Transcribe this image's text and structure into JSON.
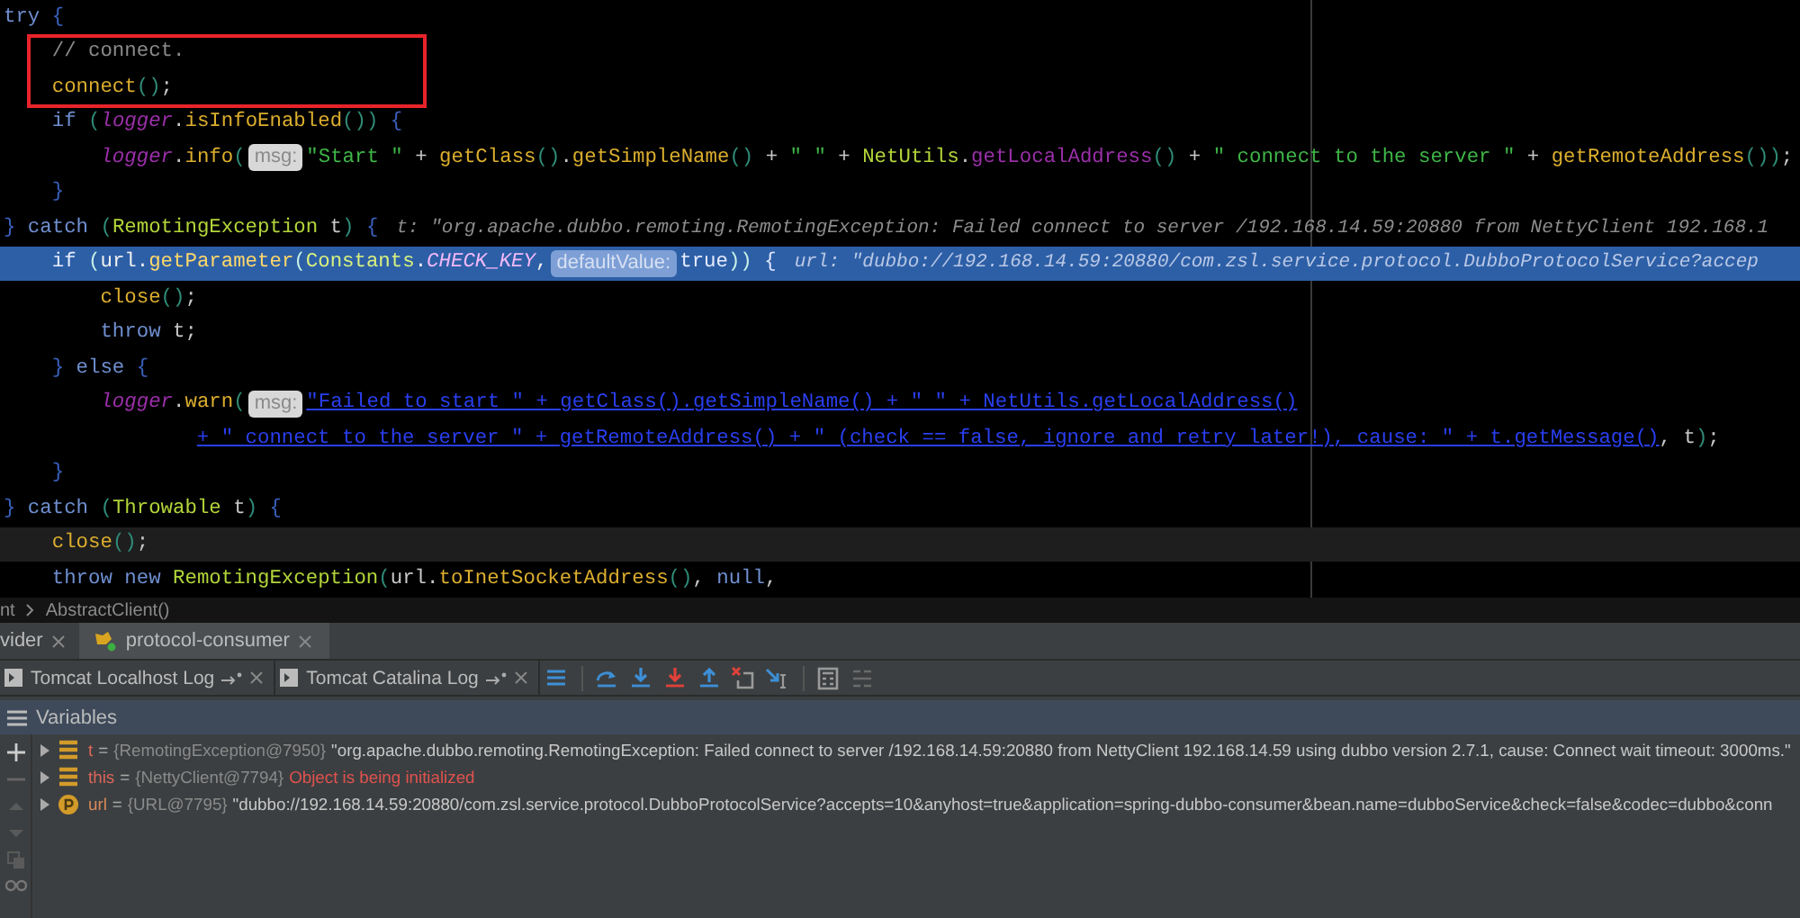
{
  "code": {
    "lines": [
      {
        "selected": false,
        "current": false,
        "boxed": false,
        "tokens": [
          {
            "kind": "kw",
            "text": "try"
          },
          {
            "kind": "brace",
            "text": " {"
          }
        ]
      },
      {
        "selected": false,
        "current": false,
        "boxed": true,
        "tokens": [
          {
            "kind": "comment",
            "text": "    // connect."
          }
        ]
      },
      {
        "selected": false,
        "current": false,
        "boxed": true,
        "tokens": [
          {
            "kind": "call",
            "text": "    connect"
          },
          {
            "kind": "paren",
            "text": "()"
          },
          {
            "kind": "plain",
            "text": ";"
          }
        ]
      },
      {
        "selected": false,
        "current": false,
        "boxed": false,
        "tokens": [
          {
            "kind": "kw",
            "text": "    if"
          },
          {
            "kind": "paren",
            "text": " ("
          },
          {
            "kind": "field",
            "text": "logger"
          },
          {
            "kind": "plain",
            "text": "."
          },
          {
            "kind": "call",
            "text": "isInfoEnabled"
          },
          {
            "kind": "paren",
            "text": "())"
          },
          {
            "kind": "brace",
            "text": " {"
          }
        ]
      },
      {
        "selected": false,
        "current": false,
        "boxed": false,
        "tokens": [
          {
            "kind": "field",
            "text": "        logger"
          },
          {
            "kind": "plain",
            "text": "."
          },
          {
            "kind": "call",
            "text": "info"
          },
          {
            "kind": "paren",
            "text": "("
          },
          {
            "kind": "hint",
            "text": "msg:"
          },
          {
            "kind": "str",
            "text": "\"Start \""
          },
          {
            "kind": "plain",
            "text": " + "
          },
          {
            "kind": "call",
            "text": "getClass"
          },
          {
            "kind": "paren",
            "text": "()"
          },
          {
            "kind": "plain",
            "text": "."
          },
          {
            "kind": "call",
            "text": "getSimpleName"
          },
          {
            "kind": "paren",
            "text": "()"
          },
          {
            "kind": "plain",
            "text": " + "
          },
          {
            "kind": "str",
            "text": "\" \""
          },
          {
            "kind": "plain",
            "text": " + "
          },
          {
            "kind": "cls",
            "text": "NetUtils"
          },
          {
            "kind": "plain",
            "text": "."
          },
          {
            "kind": "static",
            "text": "getLocalAddress"
          },
          {
            "kind": "paren",
            "text": "()"
          },
          {
            "kind": "plain",
            "text": " + "
          },
          {
            "kind": "str",
            "text": "\" connect to the server \""
          },
          {
            "kind": "plain",
            "text": " + "
          },
          {
            "kind": "call",
            "text": "getRemoteAddress"
          },
          {
            "kind": "paren",
            "text": "())"
          },
          {
            "kind": "plain",
            "text": ";"
          }
        ]
      },
      {
        "selected": false,
        "current": false,
        "boxed": false,
        "tokens": [
          {
            "kind": "brace",
            "text": "    }"
          }
        ]
      },
      {
        "selected": false,
        "current": false,
        "boxed": false,
        "tokens": [
          {
            "kind": "brace",
            "text": "}"
          },
          {
            "kind": "kw",
            "text": " catch"
          },
          {
            "kind": "paren",
            "text": " ("
          },
          {
            "kind": "cls",
            "text": "RemotingException"
          },
          {
            "kind": "plain",
            "text": " t"
          },
          {
            "kind": "paren",
            "text": ")"
          },
          {
            "kind": "brace",
            "text": " {"
          },
          {
            "kind": "debug",
            "text": "t: \"org.apache.dubbo.remoting.RemotingException: Failed connect to server /192.168.14.59:20880 from NettyClient 192.168.1"
          }
        ]
      },
      {
        "selected": true,
        "current": false,
        "boxed": false,
        "tokens": [
          {
            "kind": "kw",
            "text": "    if"
          },
          {
            "kind": "paren",
            "text": " ("
          },
          {
            "kind": "plain",
            "text": "url."
          },
          {
            "kind": "call",
            "text": "getParameter"
          },
          {
            "kind": "paren",
            "text": "("
          },
          {
            "kind": "cls",
            "text": "Constants"
          },
          {
            "kind": "plain",
            "text": "."
          },
          {
            "kind": "field",
            "text": "CHECK_KEY"
          },
          {
            "kind": "plain",
            "text": ","
          },
          {
            "kind": "hint",
            "text": "defaultValue:"
          },
          {
            "kind": "kw",
            "text": "true"
          },
          {
            "kind": "paren",
            "text": "))"
          },
          {
            "kind": "brace",
            "text": " {"
          },
          {
            "kind": "debug",
            "text": "url: \"dubbo://192.168.14.59:20880/com.zsl.service.protocol.DubboProtocolService?accep"
          }
        ]
      },
      {
        "selected": false,
        "current": false,
        "boxed": false,
        "tokens": [
          {
            "kind": "call",
            "text": "        close"
          },
          {
            "kind": "paren",
            "text": "()"
          },
          {
            "kind": "plain",
            "text": ";"
          }
        ]
      },
      {
        "selected": false,
        "current": false,
        "boxed": false,
        "tokens": [
          {
            "kind": "kw",
            "text": "        throw"
          },
          {
            "kind": "plain",
            "text": " t;"
          }
        ]
      },
      {
        "selected": false,
        "current": false,
        "boxed": false,
        "tokens": [
          {
            "kind": "brace",
            "text": "    }"
          },
          {
            "kind": "kw",
            "text": " else"
          },
          {
            "kind": "brace",
            "text": " {"
          }
        ]
      },
      {
        "selected": false,
        "current": false,
        "boxed": false,
        "tokens": [
          {
            "kind": "field",
            "text": "        logger"
          },
          {
            "kind": "plain",
            "text": "."
          },
          {
            "kind": "call",
            "text": "warn"
          },
          {
            "kind": "paren",
            "text": "("
          },
          {
            "kind": "hint",
            "text": "msg:"
          },
          {
            "kind": "link",
            "text": "\"Failed to start \" + getClass().getSimpleName() + \" \" + NetUtils.getLocalAddress()"
          }
        ]
      },
      {
        "selected": false,
        "current": false,
        "boxed": false,
        "tokens": [
          {
            "kind": "link",
            "text": "                + \" connect to the server \" + getRemoteAddress() + \" (check == false, ignore and retry later!), cause: \" + t.getMessage()"
          },
          {
            "kind": "plain",
            "text": ", t"
          },
          {
            "kind": "paren",
            "text": ")"
          },
          {
            "kind": "plain",
            "text": ";"
          }
        ]
      },
      {
        "selected": false,
        "current": false,
        "boxed": false,
        "tokens": [
          {
            "kind": "brace",
            "text": "    }"
          }
        ]
      },
      {
        "selected": false,
        "current": false,
        "boxed": false,
        "tokens": [
          {
            "kind": "brace",
            "text": "}"
          },
          {
            "kind": "kw",
            "text": " catch"
          },
          {
            "kind": "paren",
            "text": " ("
          },
          {
            "kind": "cls",
            "text": "Throwable"
          },
          {
            "kind": "plain",
            "text": " t"
          },
          {
            "kind": "paren",
            "text": ")"
          },
          {
            "kind": "brace",
            "text": " {"
          }
        ]
      },
      {
        "selected": false,
        "current": true,
        "boxed": false,
        "tokens": [
          {
            "kind": "call",
            "text": "    close"
          },
          {
            "kind": "paren",
            "text": "()"
          },
          {
            "kind": "plain",
            "text": ";"
          }
        ]
      },
      {
        "selected": false,
        "current": false,
        "boxed": false,
        "tokens": [
          {
            "kind": "kw",
            "text": "    throw"
          },
          {
            "kind": "kw",
            "text": " new"
          },
          {
            "kind": "cls",
            "text": " RemotingException"
          },
          {
            "kind": "paren",
            "text": "("
          },
          {
            "kind": "plain",
            "text": "url."
          },
          {
            "kind": "call",
            "text": "toInetSocketAddress"
          },
          {
            "kind": "paren",
            "text": "()"
          },
          {
            "kind": "plain",
            "text": ","
          },
          {
            "kind": "kw",
            "text": " null"
          },
          {
            "kind": "plain",
            "text": ","
          }
        ]
      }
    ]
  },
  "breadcrumb": [
    "nt",
    "AbstractClient()"
  ],
  "run_tabs": [
    {
      "label": "vider",
      "selected": false
    },
    {
      "label": "protocol-consumer",
      "selected": true
    }
  ],
  "log_tabs": [
    {
      "label": "Tomcat Localhost Log"
    },
    {
      "label": "Tomcat Catalina Log"
    }
  ],
  "variables": {
    "title": "Variables",
    "items": [
      {
        "kind": "field",
        "name": "t",
        "color": "#d9665a",
        "assign": "=",
        "type": "{RemotingException@7950}",
        "value": "\"org.apache.dubbo.remoting.RemotingException: Failed connect to server /192.168.14.59:20880 from NettyClient 192.168.14.59 using dubbo version 2.7.1, cause: Connect wait timeout: 3000ms.\"",
        "error": false
      },
      {
        "kind": "field",
        "name": "this",
        "color": "#d9665a",
        "assign": "=",
        "type": "{NettyClient@7794}",
        "value": "Object is being initialized",
        "error": true
      },
      {
        "kind": "parameter",
        "name": "url",
        "color": "#d98a5a",
        "assign": "=",
        "type": "{URL@7795}",
        "value": "\"dubbo://192.168.14.59:20880/com.zsl.service.protocol.DubboProtocolService?accepts=10&anyhost=true&application=spring-dubbo-consumer&bean.name=dubboService&check=false&codec=dubbo&conn",
        "error": false
      }
    ]
  }
}
